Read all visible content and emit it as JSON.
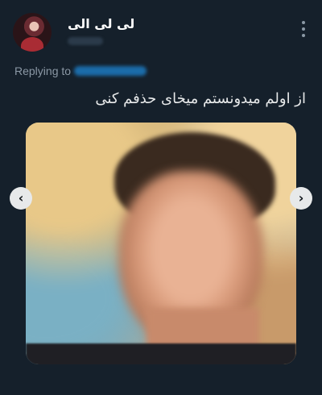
{
  "tweet": {
    "display_name": "لی لی الی",
    "replying_label": "Replying to",
    "text": "از اولم میدونستم میخای حذفم کنی"
  },
  "icons": {
    "more": "more-vertical-icon",
    "prev": "chevron-left-icon",
    "next": "chevron-right-icon"
  },
  "colors": {
    "background": "#15202b",
    "text": "#e7e9ea",
    "secondary": "#8b98a5",
    "accent": "#1d9bf0"
  }
}
